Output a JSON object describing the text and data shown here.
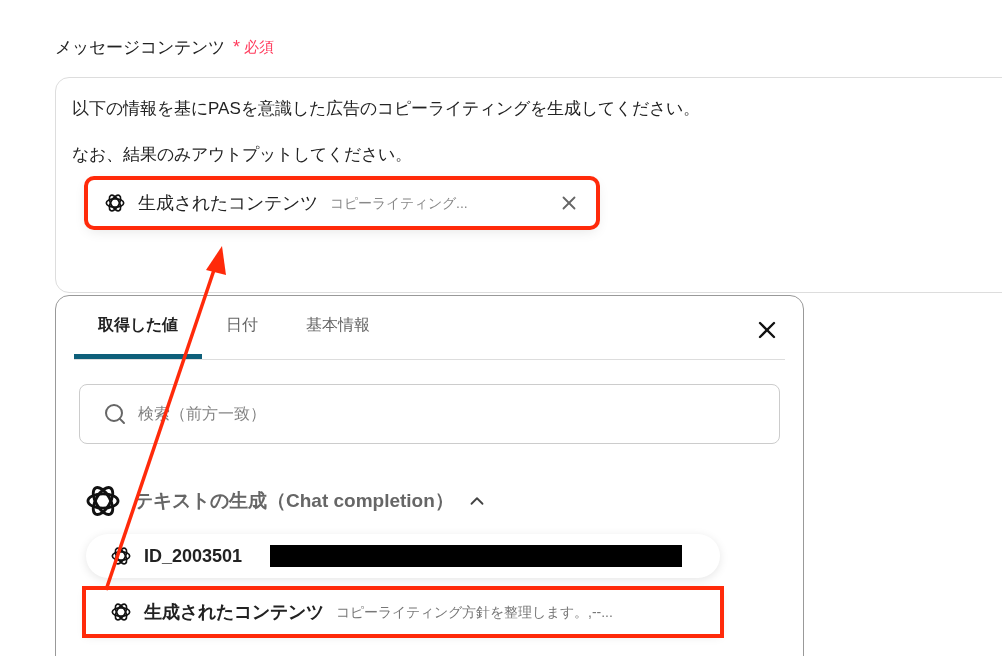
{
  "field": {
    "label": "メッセージコンテンツ",
    "required_mark": "*",
    "required_text": "必須",
    "paragraphs": [
      "以下の情報を基にPASを意識した広告のコピーライティングを生成してください。",
      "なお、結果のみアウトプットしてください。"
    ],
    "chip": {
      "title": "生成されたコンテンツ",
      "preview": "コピーライティング...",
      "highlighted": true
    }
  },
  "popup": {
    "tabs": [
      {
        "label": "取得した値",
        "selected": true
      },
      {
        "label": "日付",
        "selected": false
      },
      {
        "label": "基本情報",
        "selected": false
      }
    ],
    "search": {
      "placeholder": "検索（前方一致）"
    },
    "group": {
      "title": "テキストの生成（Chat completion）",
      "expanded": true
    },
    "items": [
      {
        "kind": "redacted",
        "name": "ID_2003501",
        "highlighted": false
      },
      {
        "kind": "text",
        "name": "生成されたコンテンツ",
        "value": "コピーライティング方針を整理します。,--...",
        "highlighted": true
      }
    ]
  },
  "annotation": {
    "kind": "arrow"
  }
}
